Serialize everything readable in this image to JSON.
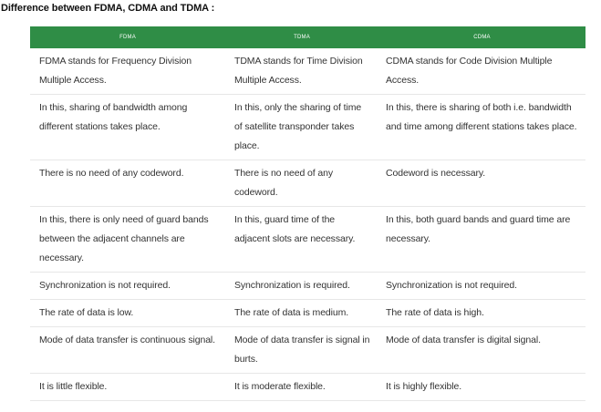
{
  "heading": "Difference between FDMA, CDMA and TDMA :",
  "table": {
    "headers": [
      "FDMA",
      "TDMA",
      "CDMA"
    ],
    "rows": [
      [
        "FDMA stands for Frequency Division Multiple Access.",
        "TDMA stands for Time Division Multiple Access.",
        "CDMA stands for Code Division Multiple Access."
      ],
      [
        "In this, sharing of bandwidth among different stations takes place.",
        "In this, only the sharing of time of satellite transponder takes place.",
        "In this, there is sharing of both i.e. bandwidth and time among different stations takes place."
      ],
      [
        "There is no need of any codeword.",
        "There is no need of any codeword.",
        "Codeword is necessary."
      ],
      [
        "In this, there is only need of guard bands between the adjacent channels are necessary.",
        "In this, guard time of the adjacent slots are necessary.",
        "In this, both guard bands and guard time are necessary."
      ],
      [
        "Synchronization is not required.",
        "Synchronization is required.",
        "Synchronization is not required."
      ],
      [
        "The rate of data is low.",
        "The rate of data is medium.",
        "The rate of data is high."
      ],
      [
        "Mode of data transfer is continuous signal.",
        "Mode of data transfer is signal in burts.",
        "Mode of data transfer is digital signal."
      ],
      [
        "It is little flexible.",
        "It is moderate flexible.",
        "It is highly flexible."
      ]
    ]
  },
  "colors": {
    "header_bg": "#2f8d46",
    "header_text": "#ffffff"
  }
}
